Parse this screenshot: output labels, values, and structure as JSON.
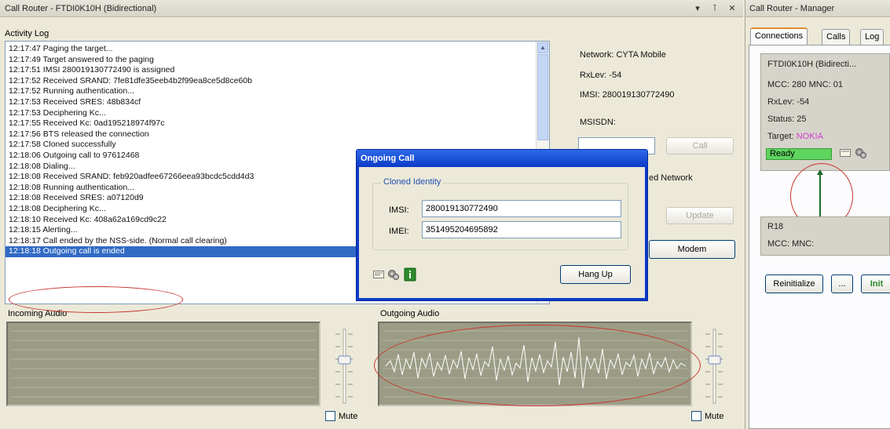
{
  "main": {
    "title": "Call Router - FTDI0K10H (Bidirectional)",
    "controls": {
      "pin": "▾",
      "dock": "⊺",
      "close": "✕"
    },
    "activity_log_label": "Activity Log",
    "log": [
      "12:17:47  Paging the target...",
      "12:17:49  Target answered to the paging",
      "12:17:51  IMSI 280019130772490 is assigned",
      "12:17:52  Received SRAND: 7fe81dfe35eeb4b2f99ea8ce5d8ce60b",
      "12:17:52  Running authentication...",
      "12:17:53  Received SRES: 48b834cf",
      "12:17:53  Deciphering Kc...",
      "12:17:55  Received Kc: 0ad195218974f97c",
      "12:17:56  BTS released the connection",
      "12:17:58  Cloned successfully",
      "12:18:06  Outgoing call to 97612468",
      "12:18:08  Dialing...",
      "12:18:08  Received SRAND: feb920adfee67266eea93bcdc5cdd4d3",
      "12:18:08  Running authentication...",
      "12:18:08  Received SRES: a07120d9",
      "12:18:08  Deciphering Kc...",
      "12:18:10  Received Kc: 408a62a169cd9c22",
      "12:18:15  Alerting...",
      "12:18:17  Call ended by the NSS-side. (Normal call clearing)",
      "12:18:18  Outgoing call is ended"
    ],
    "network": {
      "network_line": "Network:   CYTA Mobile",
      "rxlev_line": "RxLev:  -54",
      "imsi_line": "IMSI:   280019130772490",
      "msisdn_label": "MSISDN:",
      "msisdn_value": "",
      "call_button": "Call",
      "used_network_fragment": "ed Network",
      "update_button": "Update",
      "modem_button_fragment": "Modem"
    },
    "incoming_audio_label": "Incoming Audio",
    "outgoing_audio_label": "Outgoing Audio",
    "mute_label": "Mute",
    "mute_label_2": "Mute"
  },
  "dialog": {
    "title": "Ongoing Call",
    "group_label": "Cloned Identity",
    "imsi_label": "IMSI:",
    "imsi_value": "280019130772490",
    "imei_label": "IMEI:",
    "imei_value": "351495204695892",
    "hangup_button": "Hang Up"
  },
  "manager": {
    "title": "Call Router - Manager",
    "tabs": [
      "Connections",
      "Calls",
      "Log"
    ],
    "card1": {
      "device": "FTDI0K10H (Bidirecti...",
      "mcc_mnc": "MCC: 280  MNC: 01",
      "rxlev": "RxLev: -54",
      "status": "Status: 25",
      "target_label": "Target:",
      "target_value": "NOKIA",
      "ready": "Ready"
    },
    "card2": {
      "device": "R18",
      "mcc_mnc": "MCC:     MNC:"
    },
    "reinit_button": "Reinitialize",
    "more_button": "...",
    "cut_off": "Init"
  },
  "colors": {
    "selection": "#316ac5",
    "dialog_title": "#0a3bc8",
    "target": "#d23ad2",
    "ready": "#5fd45f",
    "audio_bg": "#9b9c86",
    "annotation": "#c8352f"
  }
}
